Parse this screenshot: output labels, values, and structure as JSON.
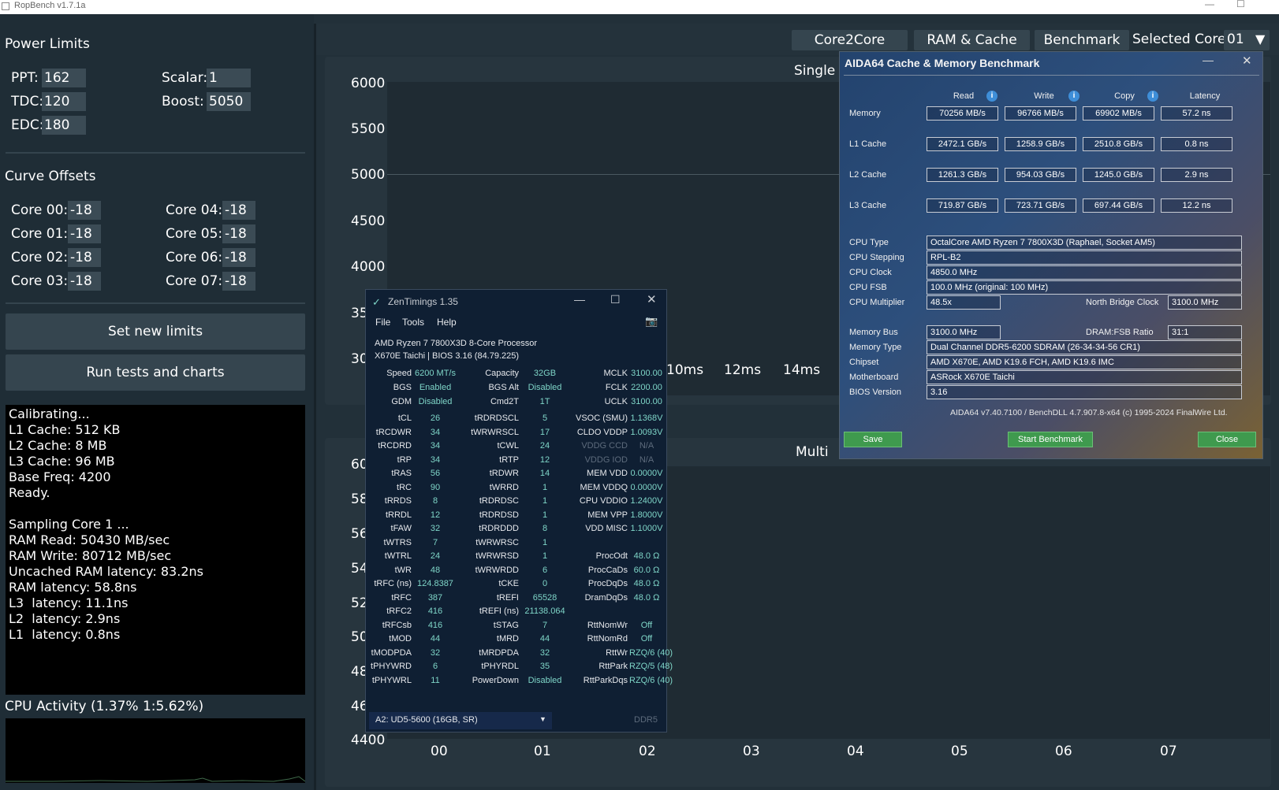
{
  "window": {
    "title": "RopBench v1.7.1a"
  },
  "power_limits": {
    "title": "Power Limits",
    "ppt_label": "PPT:",
    "ppt": "162",
    "tdc_label": "TDC:",
    "tdc": "120",
    "edc_label": "EDC:",
    "edc": "180",
    "scalar_label": "Scalar:",
    "scalar": "1",
    "boost_label": "Boost:",
    "boost": "5050"
  },
  "curve_offsets": {
    "title": "Curve Offsets",
    "items": [
      {
        "label": "Core 00:",
        "value": "-18"
      },
      {
        "label": "Core 01:",
        "value": "-18"
      },
      {
        "label": "Core 02:",
        "value": "-18"
      },
      {
        "label": "Core 03:",
        "value": "-18"
      },
      {
        "label": "Core 04:",
        "value": "-18"
      },
      {
        "label": "Core 05:",
        "value": "-18"
      },
      {
        "label": "Core 06:",
        "value": "-18"
      },
      {
        "label": "Core 07:",
        "value": "-18"
      }
    ]
  },
  "buttons": {
    "set_limits": "Set new limits",
    "run_tests": "Run tests and charts"
  },
  "log": {
    "text": "Calibrating...\nL1 Cache: 512 KB\nL2 Cache: 8 MB\nL3 Cache: 96 MB\nBase Freq: 4200\nReady.\n\nSampling Core 1 ...\nRAM Read: 50430 MB/sec\nRAM Write: 80712 MB/sec\nUncached RAM latency: 83.2ns\nRAM latency: 58.8ns\nL3  latency: 11.1ns\nL2  latency: 2.9ns\nL1  latency: 0.8ns"
  },
  "cpu_activity": {
    "label": "CPU Activity (1.37% 1:5.62%)"
  },
  "tabs": {
    "core2core": "Core2Core",
    "ram_cache": "RAM & Cache",
    "benchmark": "Benchmark",
    "selected_core_label": "Selected Core",
    "selected_core": "01"
  },
  "charts": {
    "single_title": "Single",
    "single_y_ticks": [
      "6000",
      "5500",
      "5000",
      "4500",
      "4000",
      "35",
      "30"
    ],
    "single_x_ticks": [
      "10ms",
      "12ms",
      "14ms"
    ],
    "multi_title": "Multi",
    "multi_y_ticks": [
      "60",
      "58",
      "56",
      "54",
      "52",
      "50",
      "48",
      "46",
      "4400"
    ],
    "multi_x_ticks": [
      "00",
      "01",
      "02",
      "03",
      "04",
      "05",
      "06",
      "07"
    ]
  },
  "zentimings": {
    "title": "ZenTimings 1.35",
    "menu": [
      "File",
      "Tools",
      "Help"
    ],
    "cpu": "AMD Ryzen 7 7800X3D 8-Core Processor",
    "board": "X670E Taichi | BIOS 3.16 (84.79.225)",
    "top_rows": [
      [
        "Speed",
        "6200 MT/s",
        "Capacity",
        "32GB",
        "MCLK",
        "3100.00"
      ],
      [
        "BGS",
        "Enabled",
        "BGS Alt",
        "Disabled",
        "FCLK",
        "2200.00"
      ],
      [
        "GDM",
        "Disabled",
        "Cmd2T",
        "1T",
        "UCLK",
        "3100.00"
      ]
    ],
    "rows": [
      [
        "tCL",
        "26",
        "tRDRDSCL",
        "5",
        "VSOC (SMU)",
        "1.1368V"
      ],
      [
        "tRCDWR",
        "34",
        "tWRWRSCL",
        "17",
        "CLDO VDDP",
        "1.0093V"
      ],
      [
        "tRCDRD",
        "34",
        "tCWL",
        "24",
        "VDDG CCD",
        "N/A"
      ],
      [
        "tRP",
        "34",
        "tRTP",
        "12",
        "VDDG IOD",
        "N/A"
      ],
      [
        "tRAS",
        "56",
        "tRDWR",
        "14",
        "MEM VDD",
        "0.0000V"
      ],
      [
        "tRC",
        "90",
        "tWRRD",
        "1",
        "MEM VDDQ",
        "0.0000V"
      ],
      [
        "tRRDS",
        "8",
        "tRDRDSC",
        "1",
        "CPU VDDIO",
        "1.2400V"
      ],
      [
        "tRRDL",
        "12",
        "tRDRDSD",
        "1",
        "MEM VPP",
        "1.8000V"
      ],
      [
        "tFAW",
        "32",
        "tRDRDDD",
        "8",
        "VDD MISC",
        "1.1000V"
      ],
      [
        "tWTRS",
        "7",
        "tWRWRSC",
        "1",
        "",
        ""
      ],
      [
        "tWTRL",
        "24",
        "tWRWRSD",
        "1",
        "ProcOdt",
        "48.0 Ω"
      ],
      [
        "tWR",
        "48",
        "tWRWRDD",
        "6",
        "ProcCaDs",
        "60.0 Ω"
      ],
      [
        "tRFC (ns)",
        "124.8387",
        "tCKE",
        "0",
        "ProcDqDs",
        "48.0 Ω"
      ],
      [
        "tRFC",
        "387",
        "tREFI",
        "65528",
        "DramDqDs",
        "48.0 Ω"
      ],
      [
        "tRFC2",
        "416",
        "tREFI (ns)",
        "21138.064",
        "",
        ""
      ],
      [
        "tRFCsb",
        "416",
        "tSTAG",
        "7",
        "RttNomWr",
        "Off"
      ],
      [
        "tMOD",
        "44",
        "tMRD",
        "44",
        "RttNomRd",
        "Off"
      ],
      [
        "tMODPDA",
        "32",
        "tMRDPDA",
        "32",
        "RttWr",
        "RZQ/6 (40)"
      ],
      [
        "tPHYWRD",
        "6",
        "tPHYRDL",
        "35",
        "RttPark",
        "RZQ/5 (48)"
      ],
      [
        "tPHYWRL",
        "11",
        "PowerDown",
        "Disabled",
        "RttParkDqs",
        "RZQ/6 (40)"
      ]
    ],
    "dimm": "A2: UD5-5600 (16GB, SR)",
    "mem_type": "DDR5"
  },
  "aida": {
    "title": "AIDA64 Cache & Memory Benchmark",
    "headers": [
      "Read",
      "Write",
      "Copy",
      "Latency"
    ],
    "rows": [
      {
        "label": "Memory",
        "read": "70256 MB/s",
        "write": "96766 MB/s",
        "copy": "69902 MB/s",
        "latency": "57.2 ns"
      },
      {
        "label": "L1 Cache",
        "read": "2472.1 GB/s",
        "write": "1258.9 GB/s",
        "copy": "2510.8 GB/s",
        "latency": "0.8 ns"
      },
      {
        "label": "L2 Cache",
        "read": "1261.3 GB/s",
        "write": "954.03 GB/s",
        "copy": "1245.0 GB/s",
        "latency": "2.9 ns"
      },
      {
        "label": "L3 Cache",
        "read": "719.87 GB/s",
        "write": "723.71 GB/s",
        "copy": "697.44 GB/s",
        "latency": "12.2 ns"
      }
    ],
    "cpu_type_label": "CPU Type",
    "cpu_type": "OctalCore AMD Ryzen 7 7800X3D  (Raphael, Socket AM5)",
    "cpu_stepping_label": "CPU Stepping",
    "cpu_stepping": "RPL-B2",
    "cpu_clock_label": "CPU Clock",
    "cpu_clock": "4850.0 MHz",
    "cpu_fsb_label": "CPU FSB",
    "cpu_fsb": "100.0 MHz  (original: 100 MHz)",
    "cpu_mult_label": "CPU Multiplier",
    "cpu_mult": "48.5x",
    "nb_clock_label": "North Bridge Clock",
    "nb_clock": "3100.0 MHz",
    "mem_bus_label": "Memory Bus",
    "mem_bus": "3100.0 MHz",
    "dram_fsb_label": "DRAM:FSB Ratio",
    "dram_fsb": "31:1",
    "mem_type_label": "Memory Type",
    "mem_type": "Dual Channel DDR5-6200 SDRAM  (26-34-34-56 CR1)",
    "chipset_label": "Chipset",
    "chipset": "AMD X670E, AMD K19.6 FCH, AMD K19.6 IMC",
    "motherboard_label": "Motherboard",
    "motherboard": "ASRock X670E Taichi",
    "bios_label": "BIOS Version",
    "bios": "3.16",
    "footer": "AIDA64 v7.40.7100 / BenchDLL 4.7.907.8-x64  (c) 1995-2024 FinalWire Ltd.",
    "save": "Save",
    "start": "Start Benchmark",
    "close": "Close"
  }
}
